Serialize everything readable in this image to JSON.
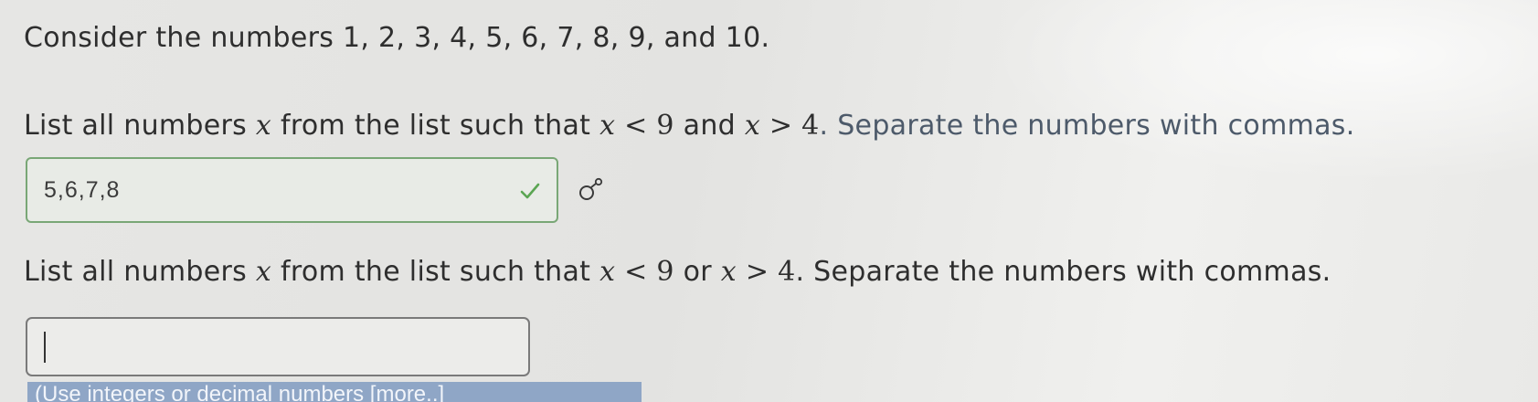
{
  "intro": {
    "text": "Consider the numbers 1, 2, 3, 4, 5, 6, 7, 8, 9, and 10."
  },
  "question1": {
    "prefix": "List all numbers ",
    "var1": "x",
    "middle1": " from the list such that ",
    "var2": "x",
    "op1": " < ",
    "n1": "9",
    "conj": " and ",
    "var3": "x",
    "op2": " > ",
    "n2": "4",
    "suffix": ". Separate the numbers with commas.",
    "answer_value": "5,6,7,8",
    "answer_status_icon": "check-icon",
    "status_color": "#5aa552"
  },
  "question2": {
    "prefix": "List all numbers ",
    "var1": "x",
    "middle1": " from the list such that ",
    "var2": "x",
    "op1": " < ",
    "n1": "9",
    "conj": " or ",
    "var3": "x",
    "op2": " > ",
    "n2": "4",
    "suffix": ". Separate the numbers with commas.",
    "answer_value": ""
  },
  "hint": {
    "text": "(Use integers or decimal numbers [more..]"
  },
  "icons": {
    "partial_credit": "partial-credit-icon"
  }
}
